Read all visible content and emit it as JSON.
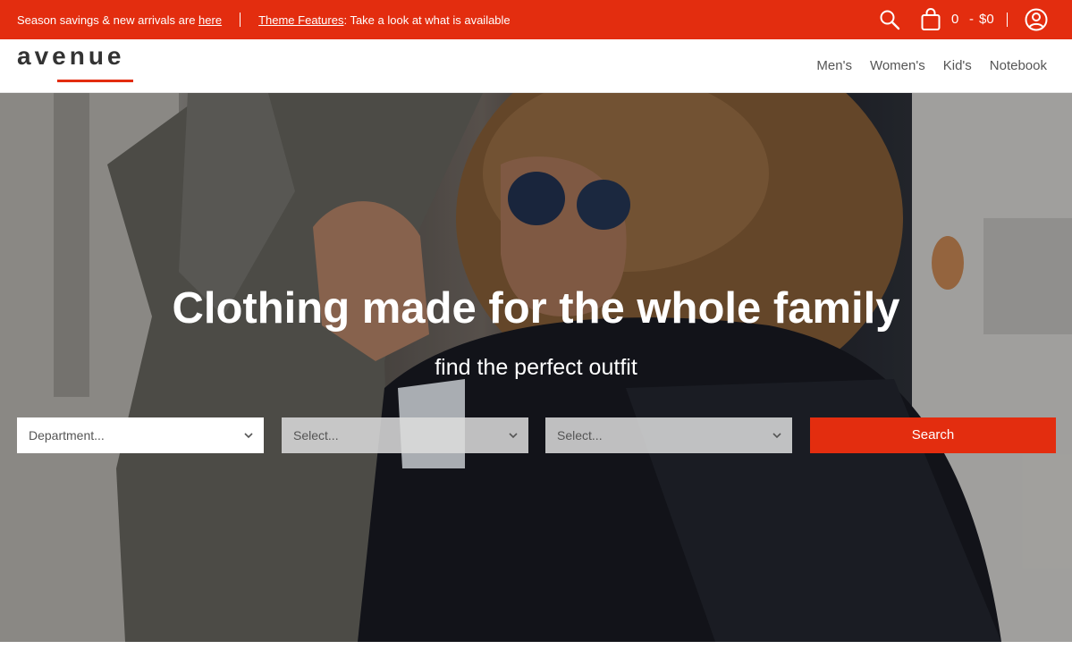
{
  "announcement": {
    "text": "Season savings & new arrivals are ",
    "link": "here",
    "feature_link": "Theme Features",
    "feature_text": ": Take a look at what is available"
  },
  "cart": {
    "count": "0",
    "dash": "-",
    "total": "$0"
  },
  "brand": {
    "logo": "avenue"
  },
  "nav": [
    "Men's",
    "Women's",
    "Kid's",
    "Notebook"
  ],
  "hero": {
    "title": "Clothing made for the whole family",
    "subtitle": "find the perfect outfit"
  },
  "filters": {
    "department_placeholder": "Department...",
    "select2_placeholder": "Select...",
    "select3_placeholder": "Select...",
    "search_label": "Search"
  },
  "icons": [
    "search-icon",
    "cart-icon",
    "account-icon",
    "chevron-down-icon"
  ],
  "colors": {
    "accent": "#e32d0f",
    "text": "#333333",
    "nav_text": "#555555"
  }
}
